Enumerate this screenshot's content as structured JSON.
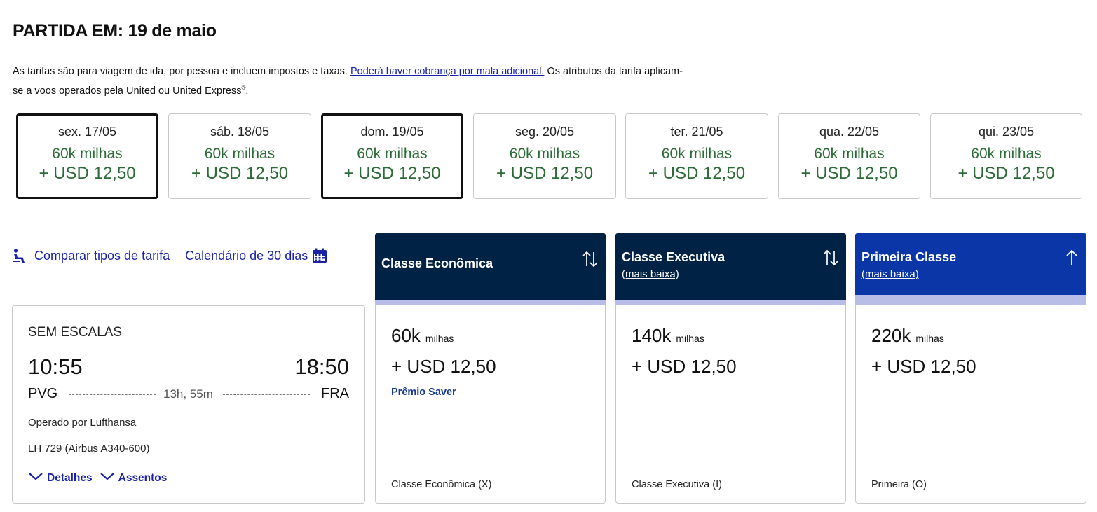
{
  "header": {
    "title": "PARTIDA EM: 19 de maio",
    "notice_before": "As tarifas são para viagem de ida, por pessoa e incluem impostos e taxas.",
    "notice_link": "Poderá haver cobrança por mala adicional.",
    "notice_after": "Os atributos da tarifa aplicam-se a voos operados pela United ou United Express",
    "notice_sup": "®",
    "notice_end": "."
  },
  "dates": [
    {
      "day": "sex. 17/05",
      "miles": "60k milhas",
      "price": "+ USD 12,50",
      "selected": true
    },
    {
      "day": "sáb. 18/05",
      "miles": "60k milhas",
      "price": "+ USD 12,50",
      "selected": false
    },
    {
      "day": "dom. 19/05",
      "miles": "60k milhas",
      "price": "+ USD 12,50",
      "selected": true
    },
    {
      "day": "seg. 20/05",
      "miles": "60k milhas",
      "price": "+ USD 12,50",
      "selected": false
    },
    {
      "day": "ter. 21/05",
      "miles": "60k milhas",
      "price": "+ USD 12,50",
      "selected": false
    },
    {
      "day": "qua. 22/05",
      "miles": "60k milhas",
      "price": "+ USD 12,50",
      "selected": false
    },
    {
      "day": "qui. 23/05",
      "miles": "60k milhas",
      "price": "+ USD 12,50",
      "selected": false
    }
  ],
  "toolbar": {
    "compare_label": "Comparar tipos de tarifa",
    "calendar_label": "Calendário de 30 dias",
    "compare_icon": "seat-icon",
    "calendar_icon": "calendar-icon"
  },
  "cabins": [
    {
      "name": "Classe Econômica",
      "sub": "",
      "sort_icon": "sort-icon",
      "active": false
    },
    {
      "name": "Classe Executiva",
      "sub": "(mais baixa)",
      "sort_icon": "sort-icon",
      "active": false
    },
    {
      "name": "Primeira Classe",
      "sub": "(mais baixa)",
      "sort_icon": "arrow-up-icon",
      "active": true
    }
  ],
  "flight": {
    "stops": "SEM ESCALAS",
    "dep_time": "10:55",
    "arr_time": "18:50",
    "dep_code": "PVG",
    "arr_code": "FRA",
    "duration": "13h, 55m",
    "operated_by": "Operado por Lufthansa",
    "flight_no": "LH 729 (Airbus A340-600)",
    "details_label": "Detalhes",
    "seats_label": "Assentos"
  },
  "fares": [
    {
      "miles": "60k",
      "miles_unit": "milhas",
      "usd": "+ USD 12,50",
      "badge": "Prêmio Saver",
      "class_code": "Classe Econômica (X)"
    },
    {
      "miles": "140k",
      "miles_unit": "milhas",
      "usd": "+ USD 12,50",
      "badge": "",
      "class_code": "Classe Executiva (I)"
    },
    {
      "miles": "220k",
      "miles_unit": "milhas",
      "usd": "+ USD 12,50",
      "badge": "",
      "class_code": "Primeira (O)"
    }
  ],
  "colors": {
    "brand_navy": "#002244",
    "brand_blue": "#0a36a8",
    "link": "#1a23a8",
    "price_green": "#2c6b38"
  }
}
